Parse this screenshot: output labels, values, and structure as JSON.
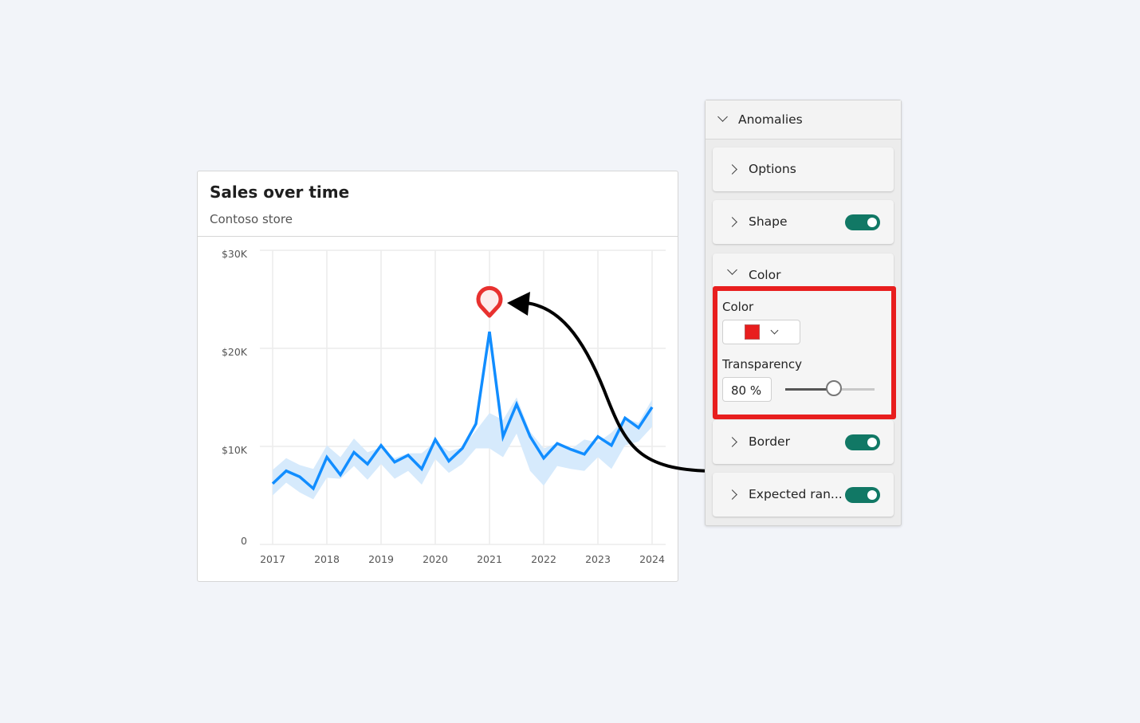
{
  "card": {
    "title": "Sales over time",
    "subtitle": "Contoso store"
  },
  "chart_data": {
    "type": "line",
    "title": "Sales over time",
    "subtitle": "Contoso store",
    "x_tick_labels": [
      "2017",
      "2018",
      "2019",
      "2020",
      "2021",
      "2022",
      "2023",
      "2024"
    ],
    "y_tick_labels": [
      "0",
      "$10K",
      "$20K",
      "$30K"
    ],
    "ylim": [
      0,
      30000
    ],
    "xlim": [
      2017,
      2024.25
    ],
    "grid": true,
    "x": [
      2017,
      2017.25,
      2017.5,
      2017.75,
      2018,
      2018.25,
      2018.5,
      2018.75,
      2019,
      2019.25,
      2019.5,
      2019.75,
      2020,
      2020.25,
      2020.5,
      2020.75,
      2021,
      2021.25,
      2021.5,
      2021.75,
      2022,
      2022.25,
      2022.5,
      2022.75,
      2023,
      2023.25,
      2023.5,
      2023.75,
      2024
    ],
    "series": [
      {
        "values": [
          6200,
          7500,
          6900,
          5700,
          8900,
          7100,
          9400,
          8200,
          10100,
          8400,
          9100,
          7700,
          10700,
          8500,
          9800,
          12300,
          21700,
          11000,
          14300,
          11000,
          8800,
          10300,
          9700,
          9200,
          11000,
          10100,
          12900,
          11900,
          14000
        ]
      }
    ],
    "expected_range": {
      "upper": [
        7600,
        8800,
        8100,
        7700,
        10100,
        8900,
        10800,
        9400,
        9900,
        8800,
        9300,
        9300,
        10500,
        9500,
        9900,
        11600,
        13400,
        12700,
        15000,
        11500,
        9800,
        10300,
        9700,
        10700,
        10400,
        11400,
        12900,
        12400,
        14800
      ],
      "lower": [
        5000,
        6300,
        5300,
        4600,
        6800,
        6700,
        8000,
        6600,
        8200,
        6700,
        7500,
        6100,
        8700,
        7300,
        8200,
        9800,
        9800,
        8900,
        11300,
        7500,
        6000,
        8000,
        7700,
        7500,
        8900,
        7700,
        10100,
        10500,
        12000
      ]
    },
    "anomalies": [
      {
        "x": 2021,
        "value": 21700
      }
    ],
    "line_color": "#118dff",
    "band_color": "#d6eafc",
    "anomaly_color": "#e8312f"
  },
  "panel": {
    "header": "Anomalies",
    "sections": [
      {
        "label": "Options"
      },
      {
        "label": "Shape",
        "toggle": true
      },
      {
        "label": "Color"
      },
      {
        "label": "Border",
        "toggle": true
      },
      {
        "label": "Expected ran...",
        "toggle": true
      }
    ],
    "color_field_label": "Color",
    "color_value": "#e81e1e",
    "transparency_label": "Transparency",
    "transparency_value": "80 %",
    "transparency_percent": 80,
    "highlight_color": "#e81e1e",
    "toggle_color": "#117865"
  }
}
